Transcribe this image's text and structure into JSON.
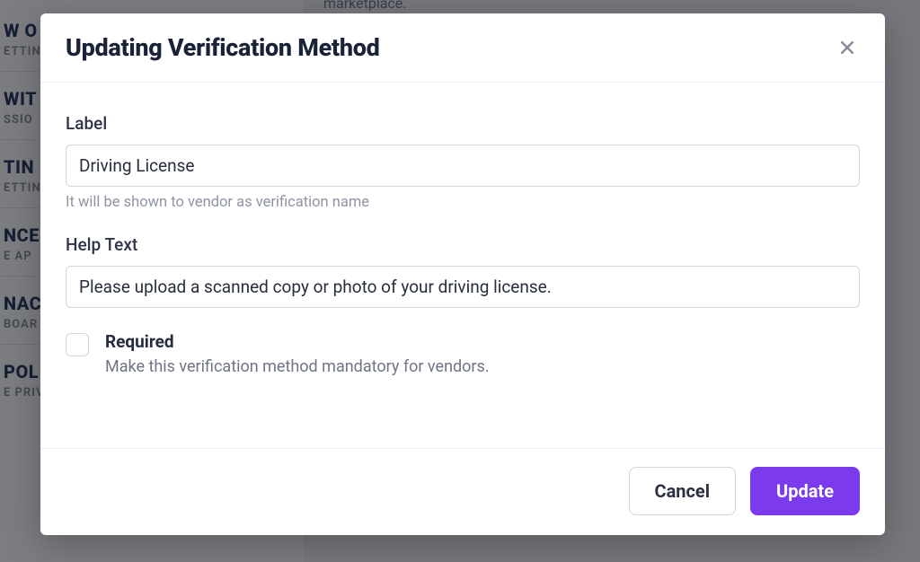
{
  "background": {
    "sidebar": [
      {
        "title": "W O",
        "sub": "ETTING"
      },
      {
        "title": "WIT",
        "sub": "SSIO"
      },
      {
        "title": "TIN",
        "sub": "ETTING"
      },
      {
        "title": "NCE",
        "sub": "E AP"
      },
      {
        "title": "NAC",
        "sub": "BOAR"
      },
      {
        "title": "POL",
        "sub": "E PRIV"
      }
    ],
    "snippet": "marketplace."
  },
  "modal": {
    "title": "Updating Verification Method",
    "fields": {
      "label": {
        "label": "Label",
        "value": "Driving License",
        "hint": "It will be shown to vendor as verification name"
      },
      "help_text": {
        "label": "Help Text",
        "value": "Please upload a scanned copy or photo of your driving license."
      },
      "required": {
        "title": "Required",
        "description": "Make this verification method mandatory for vendors.",
        "checked": false
      }
    },
    "buttons": {
      "cancel": "Cancel",
      "update": "Update"
    }
  }
}
